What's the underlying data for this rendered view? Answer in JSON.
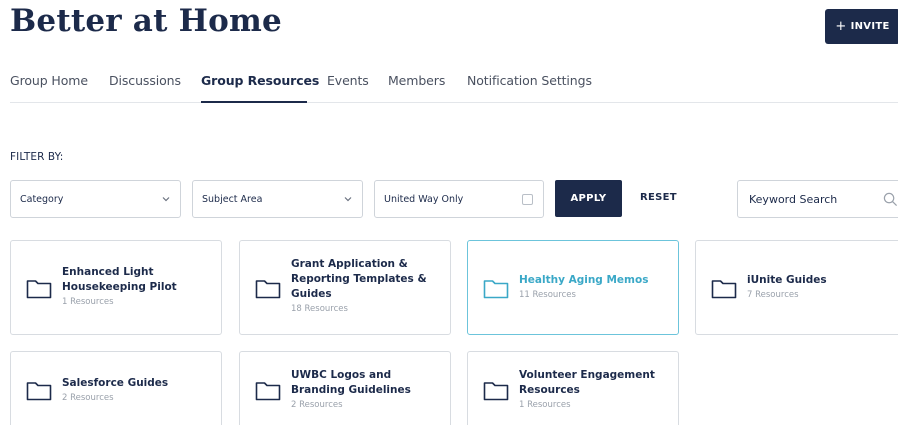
{
  "header": {
    "title": "Better at Home",
    "invite_label": "INVITE"
  },
  "tabs": [
    {
      "label": "Group Home"
    },
    {
      "label": "Discussions"
    },
    {
      "label": "Group Resources",
      "active": true
    },
    {
      "label": "Events"
    },
    {
      "label": "Members"
    },
    {
      "label": "Notification Settings"
    }
  ],
  "filter": {
    "label": "FILTER BY:",
    "category": "Category",
    "subject_area": "Subject Area",
    "united_way_only": "United Way Only",
    "apply_label": "APPLY",
    "reset_label": "RESET",
    "search_placeholder": "Keyword Search"
  },
  "resources": [
    {
      "name": "Enhanced Light Housekeeping Pilot",
      "count": "1 Resources"
    },
    {
      "name": "Grant Application & Reporting Templates & Guides",
      "count": "18 Resources"
    },
    {
      "name": "Healthy Aging Memos",
      "count": "11 Resources",
      "highlight": true
    },
    {
      "name": "iUnite Guides",
      "count": "7 Resources"
    },
    {
      "name": "Salesforce Guides",
      "count": "2 Resources"
    },
    {
      "name": "UWBC Logos and Branding Guidelines",
      "count": "2 Resources"
    },
    {
      "name": "Volunteer Engagement Resources",
      "count": "1 Resources"
    }
  ],
  "colors": {
    "navy": "#1c2a4a",
    "highlight": "#3aa8c7",
    "muted": "#9aa1ab"
  }
}
